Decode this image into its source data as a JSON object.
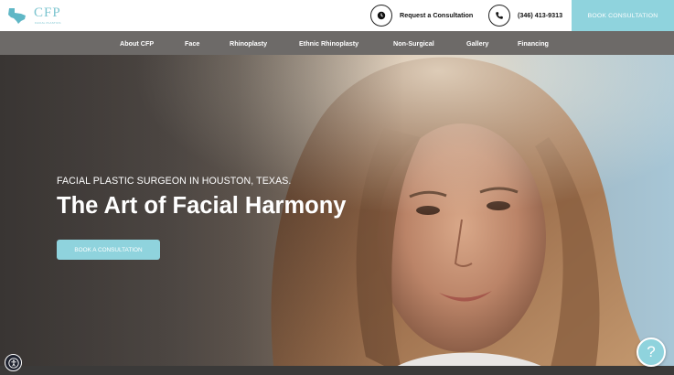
{
  "header": {
    "logo_text": "CFP",
    "logo_sub": "FACIAL PLASTICS",
    "consult_label": "Request a Consultation",
    "consult_icon": "clock-icon",
    "phone_label": "(346) 413-9313",
    "phone_icon": "phone-icon",
    "book_label": "BOOK CONSULTATION"
  },
  "nav": {
    "items": [
      {
        "label": "About CFP"
      },
      {
        "label": "Face"
      },
      {
        "label": "Rhinoplasty"
      },
      {
        "label": "Ethnic Rhinoplasty"
      },
      {
        "label": "Non-Surgical"
      },
      {
        "label": "Gallery"
      },
      {
        "label": "Financing"
      }
    ]
  },
  "hero": {
    "eyebrow": "FACIAL PLASTIC SURGEON IN HOUSTON, TEXAS.",
    "title": "The Art of Facial Harmony",
    "cta_label": "BOOK A CONSULTATION"
  },
  "widgets": {
    "help_label": "?",
    "accessibility_icon": "accessibility-icon"
  },
  "colors": {
    "accent": "#8fd3dd",
    "nav_bg": "#6d6a68",
    "logo": "#7bc4cf"
  }
}
